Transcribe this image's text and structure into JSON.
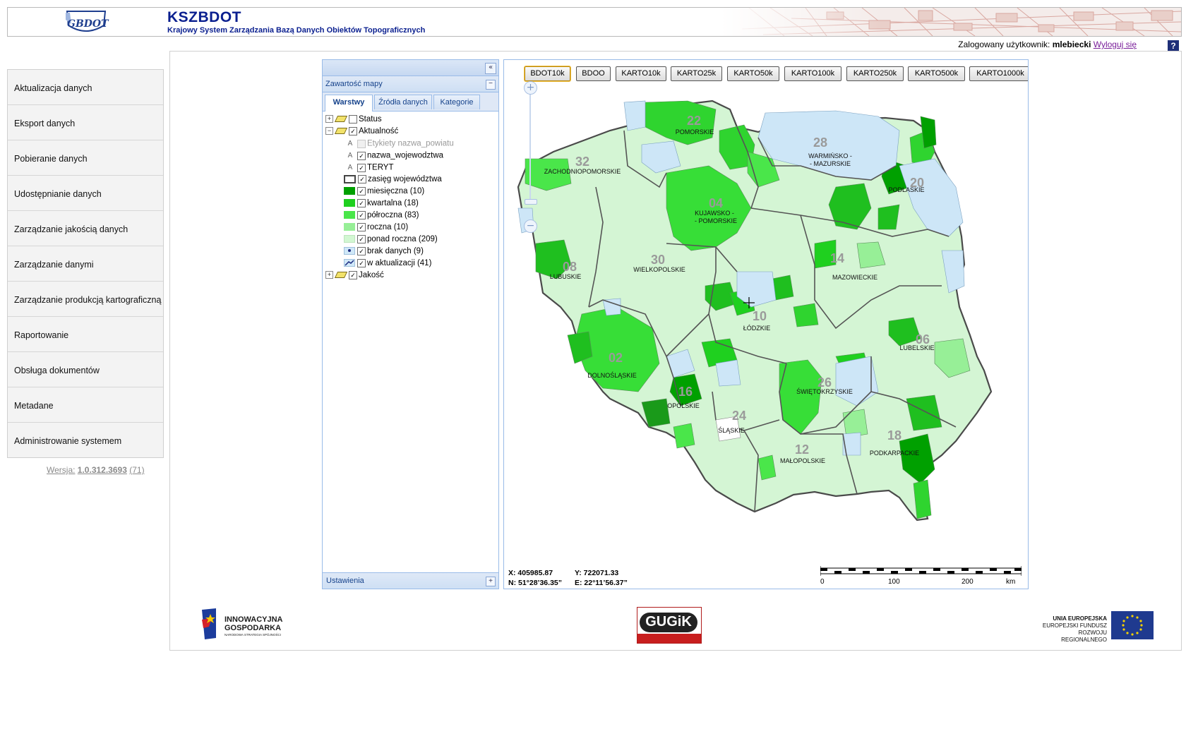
{
  "header": {
    "logo_text": "GBDOT",
    "title": "KSZBDOT",
    "subtitle": "Krajowy System Zarządzania Bazą Danych Obiektów Topograficznych"
  },
  "userbar": {
    "prefix": "Zalogowany użytkownik:",
    "username": "mlebiecki",
    "logout": "Wyloguj się",
    "help": "?"
  },
  "menu": {
    "items": [
      {
        "label": "Aktualizacja danych"
      },
      {
        "label": "Eksport danych"
      },
      {
        "label": "Pobieranie danych"
      },
      {
        "label": "Udostępnianie danych"
      },
      {
        "label": "Zarządzanie jakością danych"
      },
      {
        "label": "Zarządzanie danymi"
      },
      {
        "label": "Zarządzanie produkcją kartograficzną"
      },
      {
        "label": "Raportowanie"
      },
      {
        "label": "Obsługa dokumentów"
      },
      {
        "label": "Metadane"
      },
      {
        "label": "Administrowanie systemem"
      }
    ]
  },
  "version": {
    "label": "Wersja:",
    "number": "1.0.312.3693",
    "extra": "(71)"
  },
  "layer_panel": {
    "collapse_icon": "«",
    "title": "Zawartość mapy",
    "title_button": "−",
    "tabs": [
      "Warstwy",
      "Źródła danych",
      "Kategorie"
    ],
    "footer": "Ustawienia",
    "footer_button": "+",
    "tree": {
      "status": "Status",
      "aktualnosc": "Aktualność",
      "etykiety": "Etykiety nazwa_powiatu",
      "nazwa_woj": "nazwa_wojewodztwa",
      "teryt": "TERYT",
      "zasieg": "zasięg województwa",
      "miesieczna": "miesięczna (10)",
      "kwartalna": "kwartalna (18)",
      "polroczna": "półroczna (83)",
      "roczna": "roczna (10)",
      "ponad_roczna": "ponad roczna (209)",
      "brak_danych": "brak danych (9)",
      "w_aktualizacji": "w aktualizacji (41)",
      "jakosc": "Jakość",
      "text_icon": "A",
      "check": "✓",
      "expand": "+",
      "collapse": "−"
    },
    "legend_colors": {
      "miesieczna": "#00a000",
      "kwartalna": "#1fd01f",
      "polroczna": "#4ae64a",
      "roczna": "#97ef97",
      "ponad_roczna": "#d2f7d2",
      "brak_danych": "#d0e8f8"
    }
  },
  "map": {
    "scale_buttons": [
      "BDOT10k",
      "BDOO",
      "KARTO10k",
      "KARTO25k",
      "KARTO50k",
      "KARTO100k",
      "KARTO250k",
      "KARTO500k",
      "KARTO1000k"
    ],
    "zoom_in": "+",
    "zoom_out": "−",
    "coords": {
      "x": "X: 405985.87",
      "y": "Y: 722071.33",
      "n": "N: 51°28’36.35”",
      "e": "E: 22°11’56.37”"
    },
    "scale_labels": [
      "0",
      "100",
      "200",
      "km"
    ],
    "regions": [
      {
        "code": "22",
        "name": "POMORSKIE"
      },
      {
        "code": "28",
        "name": "WARMIŃSKO -"
      },
      {
        "code": "",
        "name": "- MAZURSKIE"
      },
      {
        "code": "32",
        "name": "ZACHODNIOPOMORSKIE"
      },
      {
        "code": "20",
        "name": "PODLASKIE"
      },
      {
        "code": "04",
        "name": "KUJAWSKO -"
      },
      {
        "code": "",
        "name": "- POMORSKIE"
      },
      {
        "code": "30",
        "name": "WIELKOPOLSKIE"
      },
      {
        "code": "14",
        "name": "MAZOWIECKIE"
      },
      {
        "code": "08",
        "name": "LUBUSKIE"
      },
      {
        "code": "10",
        "name": "ŁÓDZKIE"
      },
      {
        "code": "06",
        "name": "LUBELSKIE"
      },
      {
        "code": "02",
        "name": "DOLNOŚLĄSKIE"
      },
      {
        "code": "26",
        "name": "ŚWIĘTOKRZYSKIE"
      },
      {
        "code": "16",
        "name": "OPOLSKIE"
      },
      {
        "code": "24",
        "name": "ŚLĄSKIE"
      },
      {
        "code": "18",
        "name": "PODKARPACKIE"
      },
      {
        "code": "12",
        "name": "MAŁOPOLSKIE"
      }
    ]
  },
  "footer": {
    "ig_line1": "INNOWACYJNA",
    "ig_line2": "GOSPODARKA",
    "ig_line3": "NARODOWA STRATEGIA SPÓJNOŚCI",
    "gugik": "GUGiK",
    "ue_line1": "UNIA EUROPEJSKA",
    "ue_line2": "EUROPEJSKI FUNDUSZ",
    "ue_line3": "ROZWOJU REGIONALNEGO"
  }
}
